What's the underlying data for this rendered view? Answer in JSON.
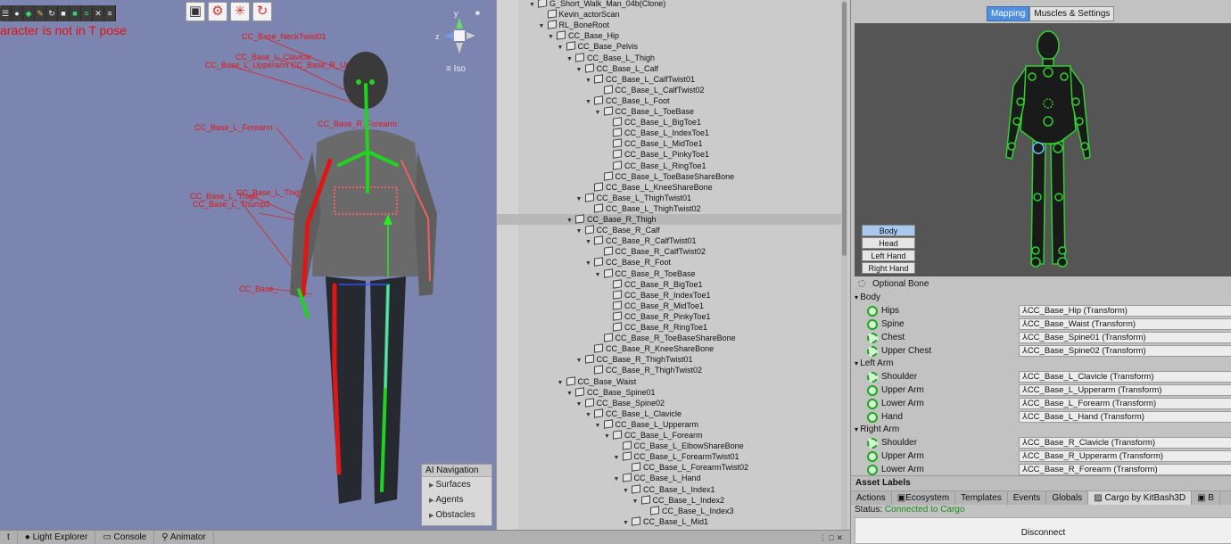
{
  "scene": {
    "warning": "aracter is not in T pose",
    "iso_label": "Iso",
    "axis_y": "y",
    "axis_z": "z",
    "bone_labels": [
      "CC_Base_NeckTwist01",
      "CC_Base_L_Clavicle",
      "CC_Base_L_Upperarm",
      "CC_Base_R_Upperarm",
      "CC_Base_L_Forearm",
      "CC_Base_R_Forearm",
      "CC_Base_L_Thigh",
      "CC_Base_L_Thump2",
      "CC_Base_L_Thigh",
      "CC_Base_"
    ],
    "ai_nav": {
      "title": "AI Navigation",
      "items": [
        "Surfaces",
        "Agents",
        "Obstacles"
      ]
    }
  },
  "hierarchy": [
    {
      "label": "G_Short_Walk_Man_04b(Clone)",
      "depth": 0,
      "expanded": true
    },
    {
      "label": "Kevin_actorScan",
      "depth": 1,
      "expanded": null
    },
    {
      "label": "RL_BoneRoot",
      "depth": 1,
      "expanded": true
    },
    {
      "label": "CC_Base_Hip",
      "depth": 2,
      "expanded": true
    },
    {
      "label": "CC_Base_Pelvis",
      "depth": 3,
      "expanded": true
    },
    {
      "label": "CC_Base_L_Thigh",
      "depth": 4,
      "expanded": true
    },
    {
      "label": "CC_Base_L_Calf",
      "depth": 5,
      "expanded": true
    },
    {
      "label": "CC_Base_L_CalfTwist01",
      "depth": 6,
      "expanded": true
    },
    {
      "label": "CC_Base_L_CalfTwist02",
      "depth": 7,
      "expanded": null
    },
    {
      "label": "CC_Base_L_Foot",
      "depth": 6,
      "expanded": true
    },
    {
      "label": "CC_Base_L_ToeBase",
      "depth": 7,
      "expanded": true
    },
    {
      "label": "CC_Base_L_BigToe1",
      "depth": 8,
      "expanded": null
    },
    {
      "label": "CC_Base_L_IndexToe1",
      "depth": 8,
      "expanded": null
    },
    {
      "label": "CC_Base_L_MidToe1",
      "depth": 8,
      "expanded": null
    },
    {
      "label": "CC_Base_L_PinkyToe1",
      "depth": 8,
      "expanded": null
    },
    {
      "label": "CC_Base_L_RingToe1",
      "depth": 8,
      "expanded": null
    },
    {
      "label": "CC_Base_L_ToeBaseShareBone",
      "depth": 7,
      "expanded": null
    },
    {
      "label": "CC_Base_L_KneeShareBone",
      "depth": 6,
      "expanded": null
    },
    {
      "label": "CC_Base_L_ThighTwist01",
      "depth": 5,
      "expanded": true
    },
    {
      "label": "CC_Base_L_ThighTwist02",
      "depth": 6,
      "expanded": null
    },
    {
      "label": "CC_Base_R_Thigh",
      "depth": 4,
      "expanded": true,
      "selected": true
    },
    {
      "label": "CC_Base_R_Calf",
      "depth": 5,
      "expanded": true
    },
    {
      "label": "CC_Base_R_CalfTwist01",
      "depth": 6,
      "expanded": true
    },
    {
      "label": "CC_Base_R_CalfTwist02",
      "depth": 7,
      "expanded": null
    },
    {
      "label": "CC_Base_R_Foot",
      "depth": 6,
      "expanded": true
    },
    {
      "label": "CC_Base_R_ToeBase",
      "depth": 7,
      "expanded": true
    },
    {
      "label": "CC_Base_R_BigToe1",
      "depth": 8,
      "expanded": null
    },
    {
      "label": "CC_Base_R_IndexToe1",
      "depth": 8,
      "expanded": null
    },
    {
      "label": "CC_Base_R_MidToe1",
      "depth": 8,
      "expanded": null
    },
    {
      "label": "CC_Base_R_PinkyToe1",
      "depth": 8,
      "expanded": null
    },
    {
      "label": "CC_Base_R_RingToe1",
      "depth": 8,
      "expanded": null
    },
    {
      "label": "CC_Base_R_ToeBaseShareBone",
      "depth": 7,
      "expanded": null
    },
    {
      "label": "CC_Base_R_KneeShareBone",
      "depth": 6,
      "expanded": null
    },
    {
      "label": "CC_Base_R_ThighTwist01",
      "depth": 5,
      "expanded": true
    },
    {
      "label": "CC_Base_R_ThighTwist02",
      "depth": 6,
      "expanded": null
    },
    {
      "label": "CC_Base_Waist",
      "depth": 3,
      "expanded": true
    },
    {
      "label": "CC_Base_Spine01",
      "depth": 4,
      "expanded": true
    },
    {
      "label": "CC_Base_Spine02",
      "depth": 5,
      "expanded": true
    },
    {
      "label": "CC_Base_L_Clavicle",
      "depth": 6,
      "expanded": true
    },
    {
      "label": "CC_Base_L_Upperarm",
      "depth": 7,
      "expanded": true
    },
    {
      "label": "CC_Base_L_Forearm",
      "depth": 8,
      "expanded": true
    },
    {
      "label": "CC_Base_L_ElbowShareBone",
      "depth": 9,
      "expanded": null
    },
    {
      "label": "CC_Base_L_ForearmTwist01",
      "depth": 9,
      "expanded": true
    },
    {
      "label": "CC_Base_L_ForearmTwist02",
      "depth": 10,
      "expanded": null
    },
    {
      "label": "CC_Base_L_Hand",
      "depth": 9,
      "expanded": true
    },
    {
      "label": "CC_Base_L_Index1",
      "depth": 10,
      "expanded": true
    },
    {
      "label": "CC_Base_L_Index2",
      "depth": 11,
      "expanded": true
    },
    {
      "label": "CC_Base_L_Index3",
      "depth": 12,
      "expanded": null
    },
    {
      "label": "CC_Base_L_Mid1",
      "depth": 10,
      "expanded": true
    }
  ],
  "inspector": {
    "tabs": [
      "Mapping",
      "Muscles & Settings"
    ],
    "body_parts": [
      "Body",
      "Head",
      "Left Hand",
      "Right Hand"
    ],
    "optional_bone": "Optional Bone",
    "sections": [
      {
        "title": "Body",
        "bones": [
          {
            "name": "Hips",
            "value": "CC_Base_Hip (Transform)",
            "optional": false
          },
          {
            "name": "Spine",
            "value": "CC_Base_Waist (Transform)",
            "optional": false
          },
          {
            "name": "Chest",
            "value": "CC_Base_Spine01 (Transform)",
            "optional": true
          },
          {
            "name": "Upper Chest",
            "value": "CC_Base_Spine02 (Transform)",
            "optional": true
          }
        ]
      },
      {
        "title": "Left Arm",
        "bones": [
          {
            "name": "Shoulder",
            "value": "CC_Base_L_Clavicle (Transform)",
            "optional": true
          },
          {
            "name": "Upper Arm",
            "value": "CC_Base_L_Upperarm (Transform)",
            "optional": false
          },
          {
            "name": "Lower Arm",
            "value": "CC_Base_L_Forearm (Transform)",
            "optional": false
          },
          {
            "name": "Hand",
            "value": "CC_Base_L_Hand (Transform)",
            "optional": false
          }
        ]
      },
      {
        "title": "Right Arm",
        "bones": [
          {
            "name": "Shoulder",
            "value": "CC_Base_R_Clavicle (Transform)",
            "optional": true
          },
          {
            "name": "Upper Arm",
            "value": "CC_Base_R_Upperarm (Transform)",
            "optional": false
          },
          {
            "name": "Lower Arm",
            "value": "CC_Base_R_Forearm (Transform)",
            "optional": false
          }
        ]
      }
    ],
    "asset_labels": "Asset Labels",
    "bottom_tabs": [
      "Actions",
      "Ecosystem",
      "Templates",
      "Events",
      "Globals",
      "Cargo by KitBash3D",
      "B"
    ],
    "status_label": "Status:",
    "status_value": "Connected to Cargo",
    "disconnect": "Disconnect"
  },
  "bottom_bar": {
    "tabs": [
      "t",
      "Light Explorer",
      "Console",
      "Animator"
    ],
    "controls": "⋮ □ ✕"
  },
  "colors": {
    "scene_bg": "#7c85b0",
    "bone_red": "#e01616",
    "bone_green": "#1fd41f",
    "accent_blue": "#4f8fe0",
    "status_green": "#1c8c1c"
  }
}
